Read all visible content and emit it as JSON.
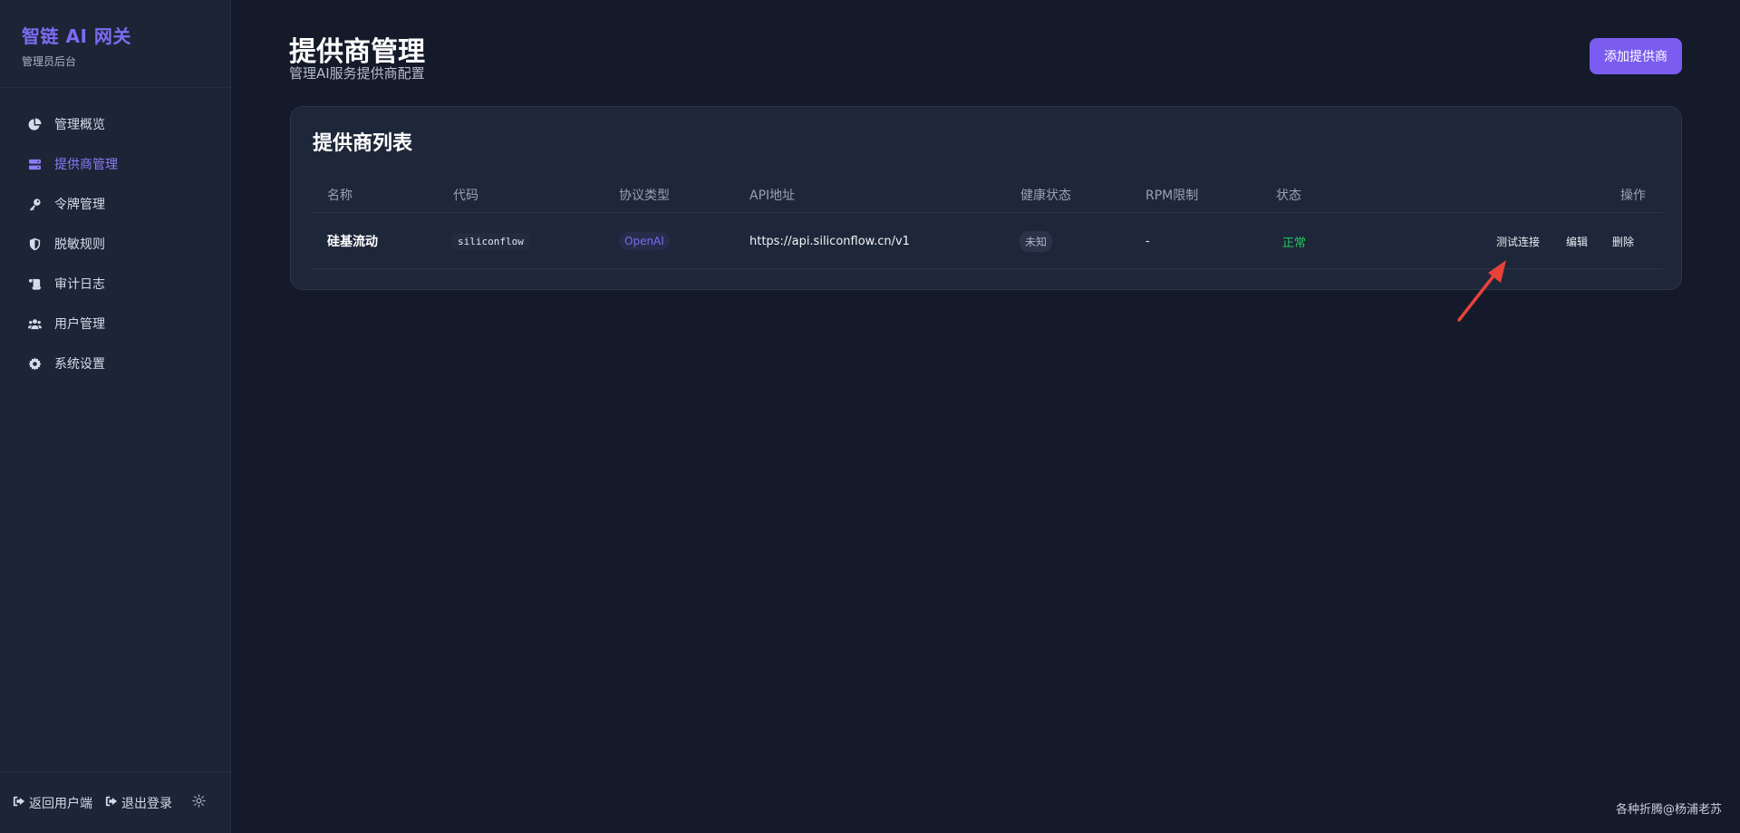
{
  "sidebar": {
    "brand_title": "智链 AI 网关",
    "brand_subtitle": "管理员后台",
    "items": [
      {
        "label": "管理概览",
        "icon": "pie-chart-icon",
        "active": false
      },
      {
        "label": "提供商管理",
        "icon": "server-icon",
        "active": true
      },
      {
        "label": "令牌管理",
        "icon": "key-icon",
        "active": false
      },
      {
        "label": "脱敏规则",
        "icon": "shield-icon",
        "active": false
      },
      {
        "label": "审计日志",
        "icon": "scroll-icon",
        "active": false
      },
      {
        "label": "用户管理",
        "icon": "users-icon",
        "active": false
      },
      {
        "label": "系统设置",
        "icon": "gear-icon",
        "active": false
      }
    ],
    "footer": {
      "back_label": "返回用户端",
      "logout_label": "退出登录",
      "theme_icon": "sun-icon"
    }
  },
  "header": {
    "title": "提供商管理",
    "subtitle": "管理AI服务提供商配置",
    "add_button": "添加提供商"
  },
  "table": {
    "title": "提供商列表",
    "columns": [
      "名称",
      "代码",
      "协议类型",
      "API地址",
      "健康状态",
      "RPM限制",
      "状态",
      "操作"
    ],
    "rows": [
      {
        "name": "硅基流动",
        "code": "siliconflow",
        "protocol": "OpenAI",
        "api_url": "https://api.siliconflow.cn/v1",
        "health": "未知",
        "rpm": "-",
        "status": "正常",
        "actions": [
          "测试连接",
          "编辑",
          "删除"
        ]
      }
    ]
  },
  "annotation": {
    "arrow_color": "#e8423a"
  },
  "watermark": "各种折腾@杨浦老苏",
  "colors": {
    "accent": "#7b5cf0",
    "background": "#141a29",
    "sidebar": "#1c2436",
    "card": "#1e2739",
    "status_ok": "#22c55e"
  }
}
